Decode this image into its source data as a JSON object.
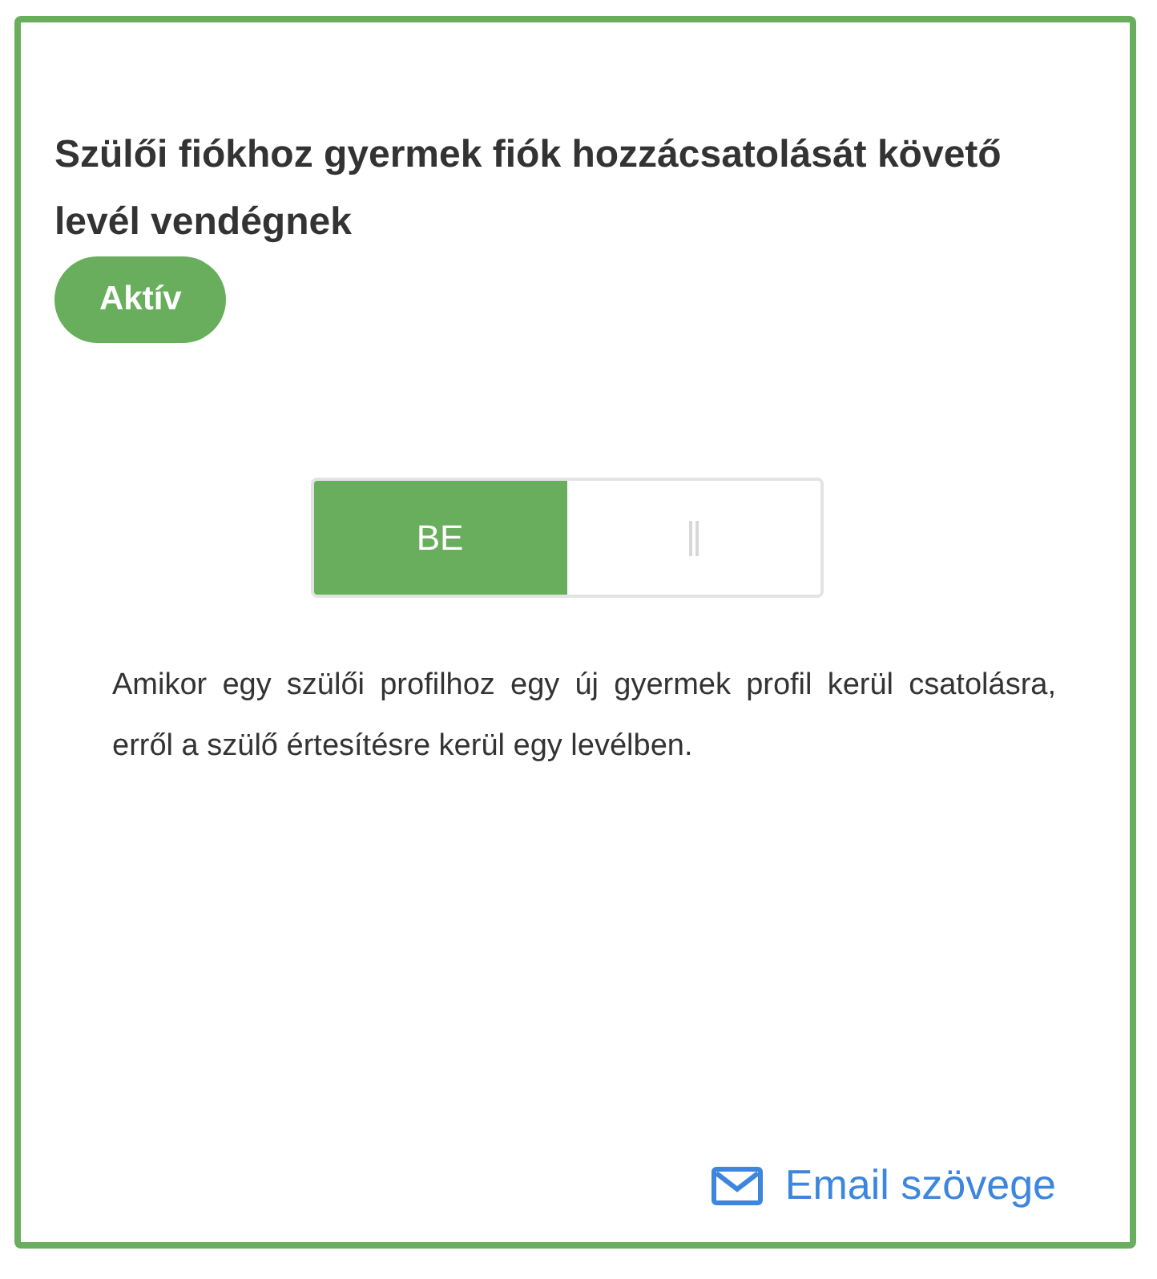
{
  "card": {
    "title": "Szülői fiókhoz gyermek fiók hozzácsatolását követő levél vendégnek",
    "status_badge": "Aktív",
    "toggle": {
      "on_label": "BE",
      "on": true
    },
    "description": "Amikor egy szülői profilhoz egy új gyermek profil kerül csatolásra, erről a szülő értesítésre kerül egy levélben.",
    "email_link": "Email szövege"
  }
}
